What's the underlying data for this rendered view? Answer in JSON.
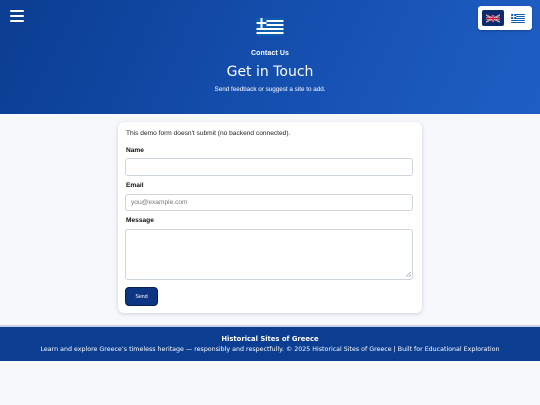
{
  "header": {
    "menu_icon": "hamburger-menu-icon",
    "logo_icon": "greek-flag-icon",
    "kicker": "Contact Us",
    "title": "Get in Touch",
    "subtitle": "Send feedback or suggest a site to add.",
    "colors": {
      "primary": "#0b3d91",
      "flag_blue": "#0d5eaf"
    }
  },
  "language_switcher": [
    {
      "icon": "uk-flag-icon",
      "active": true
    },
    {
      "icon": "greek-flag-icon",
      "active": false
    }
  ],
  "form": {
    "note": "This demo form doesn't submit (no backend connected).",
    "name_label": "Name",
    "name_value": "",
    "email_label": "Email",
    "email_placeholder": "you@example.com",
    "message_label": "Message",
    "message_value": "",
    "send_label": "Send"
  },
  "footer": {
    "title": "Historical Sites of Greece",
    "text": "Learn and explore Greece’s timeless heritage — responsibly and respectfully. © 2025 Historical Sites of Greece | Built for Educational Exploration"
  }
}
